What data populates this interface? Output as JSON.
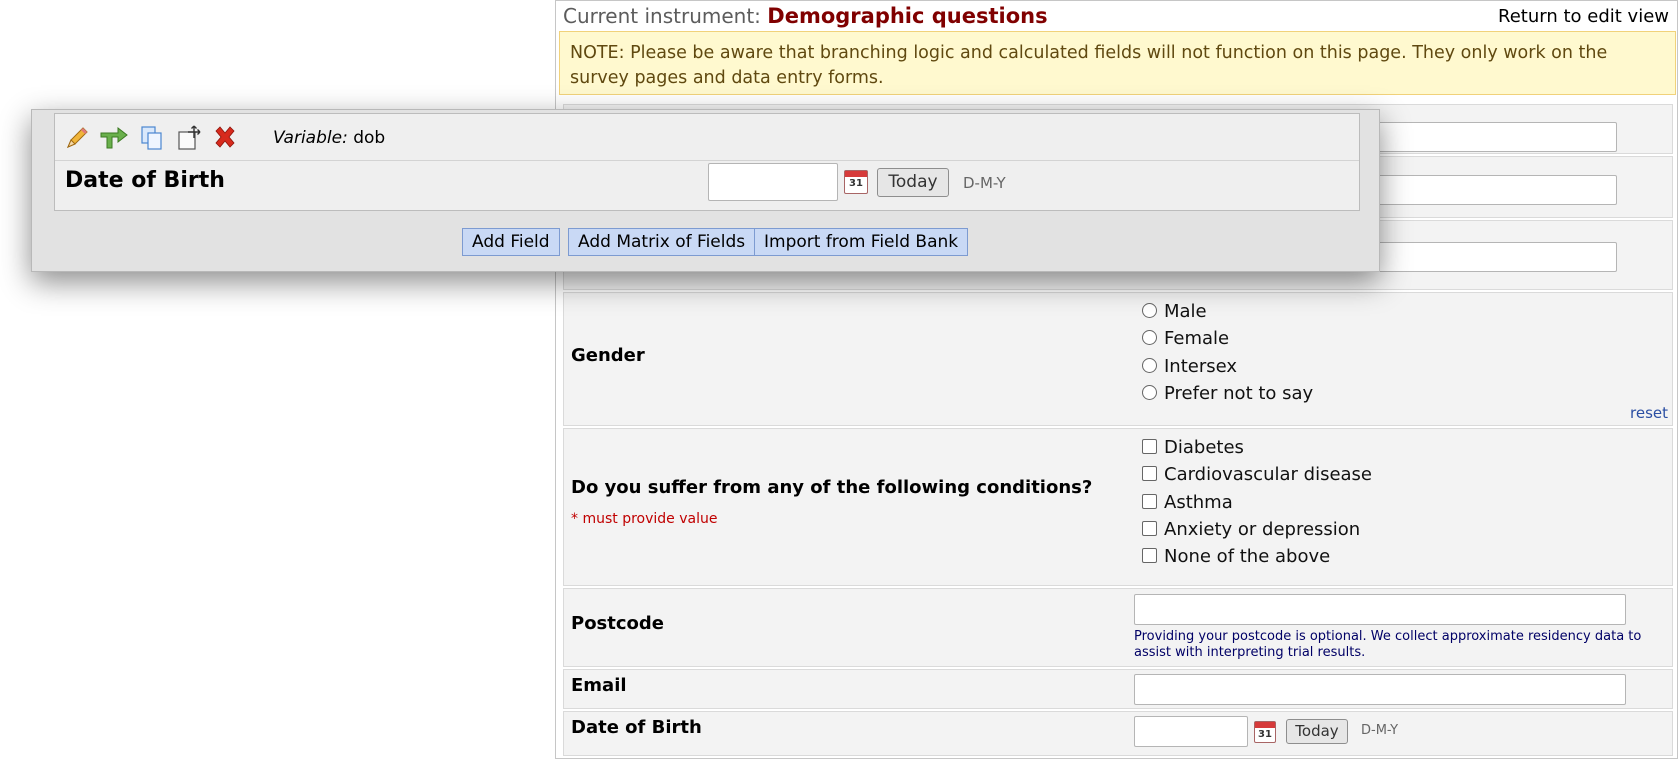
{
  "header": {
    "current_label": "Current instrument:",
    "instrument_name": "Demographic questions",
    "return_link": "Return to edit view"
  },
  "note": "NOTE: Please be aware that branching logic and calculated fields will not function on this page. They only work on the survey pages and data entry forms.",
  "gender": {
    "label": "Gender",
    "options": [
      "Male",
      "Female",
      "Intersex",
      "Prefer not to say"
    ],
    "reset": "reset"
  },
  "conditions": {
    "label": "Do you suffer from any of the following conditions?",
    "required": "* must provide value",
    "options": [
      "Diabetes",
      "Cardiovascular disease",
      "Asthma",
      "Anxiety or depression",
      "None of the above"
    ]
  },
  "postcode": {
    "label": "Postcode",
    "help": "Providing your postcode is optional. We collect approximate residency data to assist with interpreting trial results."
  },
  "email": {
    "label": "Email"
  },
  "dob": {
    "label": "Date of Birth",
    "today": "Today",
    "format": "D-M-Y",
    "cal_day": "31"
  },
  "editor": {
    "variable_prefix": "Variable:",
    "variable_name": "dob",
    "field_label": "Date of Birth",
    "today": "Today",
    "format": "D-M-Y",
    "cal_day": "31",
    "add_field": "Add Field",
    "add_matrix": "Add Matrix of Fields",
    "import_bank": "Import from Field Bank"
  },
  "icons": {
    "edit": "pencil-icon",
    "branching": "branching-logic-icon",
    "copy": "copy-icon",
    "move": "move-icon",
    "delete": "delete-icon",
    "calendar": "calendar-icon"
  }
}
